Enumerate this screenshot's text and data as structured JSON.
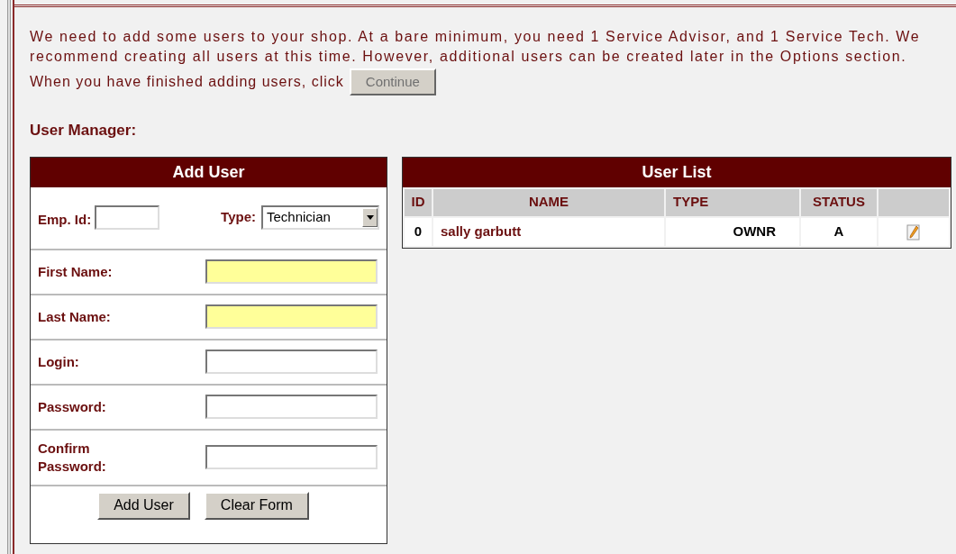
{
  "intro": {
    "text": "We need to add some users to your shop. At a bare minimum, you need 1 Service Advisor, and 1 Service Tech. We recommend creating all users at this time. However, additional users can be created later in the Options section.",
    "prompt": "When you have finished adding users, click",
    "continue_button": {
      "label": "Continue",
      "disabled": true
    }
  },
  "section_title": "User Manager:",
  "add_user": {
    "title": "Add User",
    "emp_id": {
      "label": "Emp. Id:"
    },
    "type": {
      "label": "Type:",
      "value": "Technician"
    },
    "fields": [
      {
        "label": "First Name:",
        "required": true
      },
      {
        "label": "Last Name:",
        "required": true
      },
      {
        "label": "Login:",
        "required": false
      },
      {
        "label": "Password:",
        "required": false
      },
      {
        "label": "Confirm Password:",
        "required": false
      }
    ],
    "buttons": [
      "Add User",
      "Clear Form"
    ]
  },
  "user_list": {
    "title": "User List",
    "columns": [
      "ID",
      "NAME",
      "TYPE",
      "STATUS"
    ],
    "rows": [
      {
        "id": "0",
        "name": "sally garbutt",
        "type": "OWNR",
        "status": "A"
      }
    ]
  }
}
